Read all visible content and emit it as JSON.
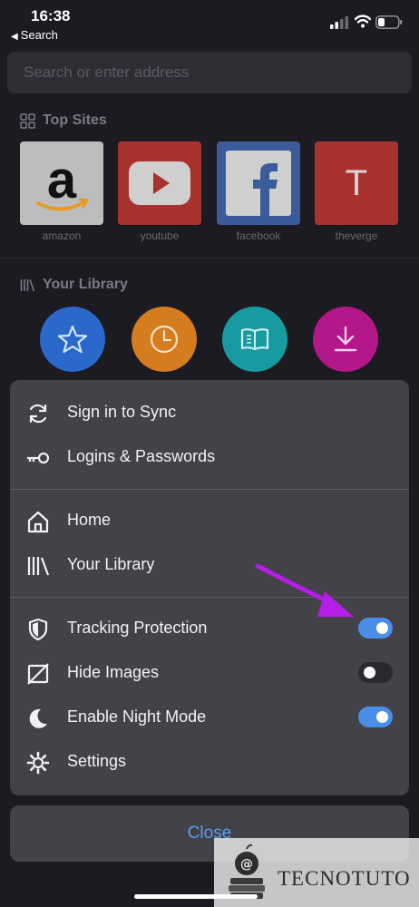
{
  "status_bar": {
    "time": "16:38",
    "back_label": "Search"
  },
  "address_bar": {
    "placeholder": "Search or enter address"
  },
  "top_sites": {
    "title": "Top Sites",
    "sites": [
      {
        "label": "amazon",
        "icon": "amazon-logo"
      },
      {
        "label": "youtube",
        "icon": "youtube-logo"
      },
      {
        "label": "facebook",
        "icon": "facebook-logo"
      },
      {
        "label": "theverge",
        "icon": "letter-t",
        "letter": "T"
      }
    ]
  },
  "library": {
    "title": "Your Library",
    "items": [
      {
        "icon": "star-icon",
        "color": "#2a68c9"
      },
      {
        "icon": "clock-icon",
        "color": "#d47c1e"
      },
      {
        "icon": "reading-list-icon",
        "color": "#189aa1"
      },
      {
        "icon": "download-icon",
        "color": "#b3178a"
      }
    ]
  },
  "menu": {
    "items": [
      {
        "label": "Sign in to Sync",
        "icon": "sync-icon"
      },
      {
        "label": "Logins & Passwords",
        "icon": "key-icon"
      },
      {
        "label": "Home",
        "icon": "home-icon"
      },
      {
        "label": "Your Library",
        "icon": "library-icon"
      },
      {
        "label": "Tracking Protection",
        "icon": "shield-icon",
        "toggle": true
      },
      {
        "label": "Hide Images",
        "icon": "hide-image-icon",
        "toggle": false
      },
      {
        "label": "Enable Night Mode",
        "icon": "moon-icon",
        "toggle": true
      },
      {
        "label": "Settings",
        "icon": "gear-icon"
      }
    ]
  },
  "close_button": {
    "label": "Close"
  },
  "watermark": {
    "text": "TECNOTUTO"
  },
  "colors": {
    "accent": "#4a8ee8",
    "annotation_arrow": "#b41ee6",
    "menu_bg": "#434248",
    "page_bg": "#1c1b22"
  }
}
